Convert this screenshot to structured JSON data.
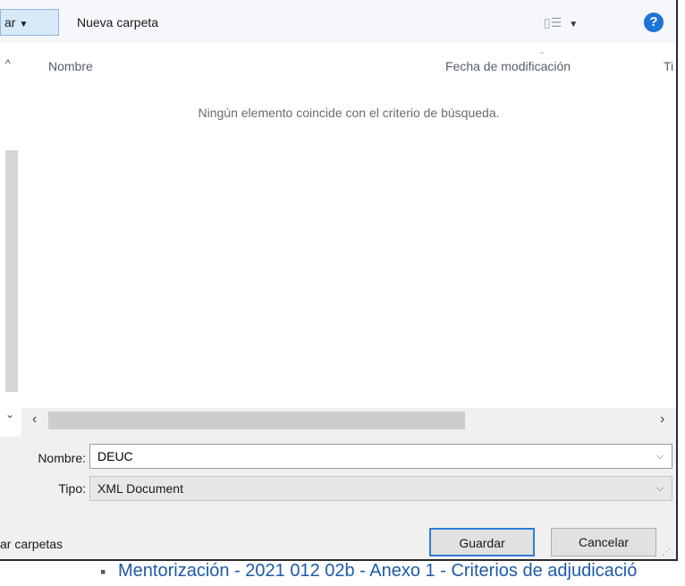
{
  "toolbar": {
    "organize_label": "ar",
    "new_folder_label": "Nueva carpeta",
    "view_icon": "list-view-icon",
    "help_icon": "help-icon",
    "help_glyph": "?"
  },
  "columns": {
    "name": "Nombre",
    "date": "Fecha de modificación",
    "type": "Ti"
  },
  "file_list": {
    "empty_message": "Ningún elemento coincide con el criterio de búsqueda."
  },
  "form": {
    "name_label": "Nombre:",
    "name_value": "DEUC",
    "type_label": "Tipo:",
    "type_value": "XML Document"
  },
  "footer": {
    "hide_folders_label": "ar carpetas",
    "save_label": "Guardar",
    "cancel_label": "Cancelar"
  },
  "background": {
    "link_text": "Mentorización - 2021 012 02b - Anexo 1 - Criterios de adjudicació"
  },
  "colors": {
    "accent": "#2f7cd6",
    "help_icon": "#1e73d6",
    "link": "#1e5aa8"
  }
}
